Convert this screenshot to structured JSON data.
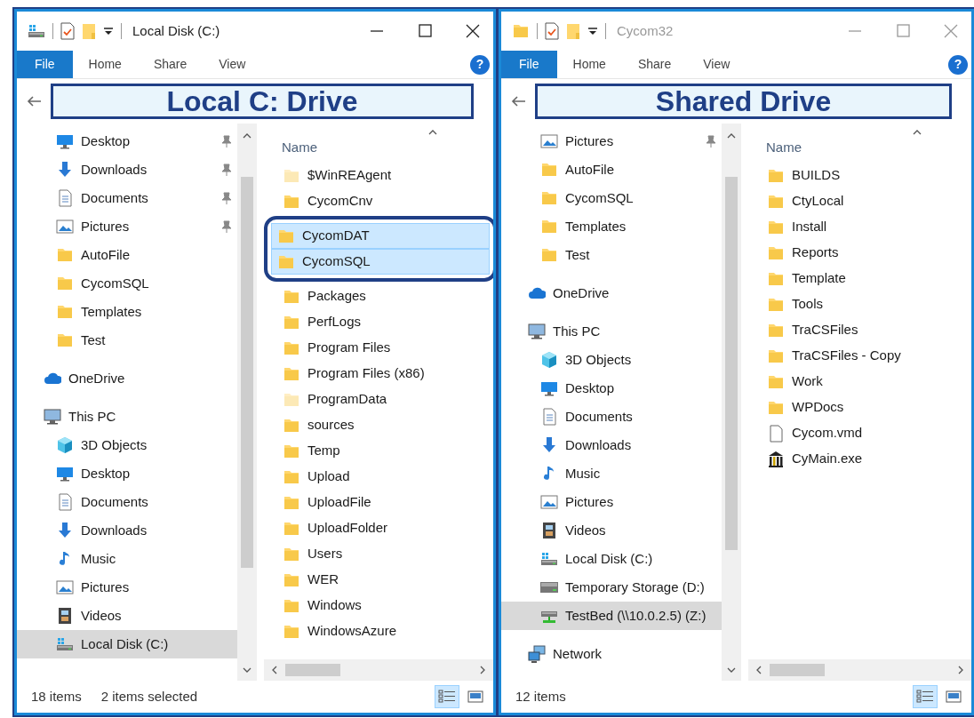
{
  "windows": [
    {
      "title": "Local Disk (C:)",
      "title_icon": {
        "kind": "drive"
      },
      "active": true,
      "ribbon_tabs": [
        {
          "label": "File",
          "selected": true
        },
        {
          "label": "Home",
          "selected": false
        },
        {
          "label": "Share",
          "selected": false
        },
        {
          "label": "View",
          "selected": false
        }
      ],
      "help": "?",
      "banner": "Local C: Drive",
      "nav": [
        {
          "children": [
            {
              "label": "Desktop",
              "kind": "desktop",
              "pinned": true,
              "selected": false
            },
            {
              "label": "Downloads",
              "kind": "downloads",
              "pinned": true,
              "selected": false
            },
            {
              "label": "Documents",
              "kind": "documents",
              "pinned": true,
              "selected": false
            },
            {
              "label": "Pictures",
              "kind": "pictures",
              "pinned": true,
              "selected": false
            },
            {
              "label": "AutoFile",
              "kind": "folder",
              "pinned": false,
              "selected": false
            },
            {
              "label": "CycomSQL",
              "kind": "folder",
              "pinned": false,
              "selected": false
            },
            {
              "label": "Templates",
              "kind": "folder",
              "pinned": false,
              "selected": false
            },
            {
              "label": "Test",
              "kind": "folder",
              "pinned": false,
              "selected": false
            }
          ]
        },
        {
          "label": "OneDrive",
          "kind": "onedrive",
          "selected": false
        },
        {
          "label": "This PC",
          "kind": "pc",
          "selected": false,
          "children": [
            {
              "label": "3D Objects",
              "kind": "objects3d",
              "selected": false
            },
            {
              "label": "Desktop",
              "kind": "desktop",
              "selected": false
            },
            {
              "label": "Documents",
              "kind": "documents",
              "selected": false
            },
            {
              "label": "Downloads",
              "kind": "downloads",
              "selected": false
            },
            {
              "label": "Music",
              "kind": "music",
              "selected": false
            },
            {
              "label": "Pictures",
              "kind": "pictures",
              "selected": false
            },
            {
              "label": "Videos",
              "kind": "videos",
              "selected": false
            },
            {
              "label": "Local Disk (C:)",
              "kind": "drive",
              "selected": true
            }
          ]
        }
      ],
      "file_list": {
        "header": "Name",
        "items": [
          {
            "name": "$WinREAgent",
            "kind": "folder",
            "hidden": true,
            "selected": false
          },
          {
            "name": "CycomCnv",
            "kind": "folder",
            "hidden": false,
            "selected": false
          },
          {
            "name": "CycomDAT",
            "kind": "folder",
            "hidden": false,
            "selected": true
          },
          {
            "name": "CycomSQL",
            "kind": "folder",
            "hidden": false,
            "selected": true
          },
          {
            "name": "Packages",
            "kind": "folder",
            "hidden": false,
            "selected": false
          },
          {
            "name": "PerfLogs",
            "kind": "folder",
            "hidden": false,
            "selected": false
          },
          {
            "name": "Program Files",
            "kind": "folder",
            "hidden": false,
            "selected": false
          },
          {
            "name": "Program Files (x86)",
            "kind": "folder",
            "hidden": false,
            "selected": false
          },
          {
            "name": "ProgramData",
            "kind": "folder",
            "hidden": true,
            "selected": false
          },
          {
            "name": "sources",
            "kind": "folder",
            "hidden": false,
            "selected": false
          },
          {
            "name": "Temp",
            "kind": "folder",
            "hidden": false,
            "selected": false
          },
          {
            "name": "Upload",
            "kind": "folder",
            "hidden": false,
            "selected": false
          },
          {
            "name": "UploadFile",
            "kind": "folder",
            "hidden": false,
            "selected": false
          },
          {
            "name": "UploadFolder",
            "kind": "folder",
            "hidden": false,
            "selected": false
          },
          {
            "name": "Users",
            "kind": "folder",
            "hidden": false,
            "selected": false
          },
          {
            "name": "WER",
            "kind": "folder",
            "hidden": false,
            "selected": false
          },
          {
            "name": "Windows",
            "kind": "folder",
            "hidden": false,
            "selected": false
          },
          {
            "name": "WindowsAzure",
            "kind": "folder",
            "hidden": false,
            "selected": false
          }
        ]
      },
      "status": [
        "18 items",
        "2 items selected"
      ]
    },
    {
      "title": "Cycom32",
      "title_icon": {
        "kind": "folder"
      },
      "active": false,
      "ribbon_tabs": [
        {
          "label": "File",
          "selected": true
        },
        {
          "label": "Home",
          "selected": false
        },
        {
          "label": "Share",
          "selected": false
        },
        {
          "label": "View",
          "selected": false
        }
      ],
      "help": "?",
      "banner": "Shared Drive",
      "nav": [
        {
          "children": [
            {
              "label": "Pictures",
              "kind": "pictures",
              "pinned": true,
              "selected": false
            },
            {
              "label": "AutoFile",
              "kind": "folder",
              "pinned": false,
              "selected": false
            },
            {
              "label": "CycomSQL",
              "kind": "folder",
              "pinned": false,
              "selected": false
            },
            {
              "label": "Templates",
              "kind": "folder",
              "pinned": false,
              "selected": false
            },
            {
              "label": "Test",
              "kind": "folder",
              "pinned": false,
              "selected": false
            }
          ]
        },
        {
          "label": "OneDrive",
          "kind": "onedrive",
          "selected": false
        },
        {
          "label": "This PC",
          "kind": "pc",
          "selected": false,
          "children": [
            {
              "label": "3D Objects",
              "kind": "objects3d",
              "selected": false
            },
            {
              "label": "Desktop",
              "kind": "desktop",
              "selected": false
            },
            {
              "label": "Documents",
              "kind": "documents",
              "selected": false
            },
            {
              "label": "Downloads",
              "kind": "downloads",
              "selected": false
            },
            {
              "label": "Music",
              "kind": "music",
              "selected": false
            },
            {
              "label": "Pictures",
              "kind": "pictures",
              "selected": false
            },
            {
              "label": "Videos",
              "kind": "videos",
              "selected": false
            },
            {
              "label": "Local Disk (C:)",
              "kind": "drive",
              "selected": false
            },
            {
              "label": "Temporary Storage (D:)",
              "kind": "tempdrive",
              "selected": false
            },
            {
              "label": "TestBed (\\\\10.0.2.5) (Z:)",
              "kind": "netdrive",
              "selected": true
            }
          ]
        },
        {
          "label": "Network",
          "kind": "network",
          "selected": false
        }
      ],
      "file_list": {
        "header": "Name",
        "items": [
          {
            "name": "BUILDS",
            "kind": "folder",
            "hidden": false,
            "selected": false
          },
          {
            "name": "CtyLocal",
            "kind": "folder",
            "hidden": false,
            "selected": false
          },
          {
            "name": "Install",
            "kind": "folder",
            "hidden": false,
            "selected": false
          },
          {
            "name": "Reports",
            "kind": "folder",
            "hidden": false,
            "selected": false
          },
          {
            "name": "Template",
            "kind": "folder",
            "hidden": false,
            "selected": false
          },
          {
            "name": "Tools",
            "kind": "folder",
            "hidden": false,
            "selected": false
          },
          {
            "name": "TraCSFiles",
            "kind": "folder",
            "hidden": false,
            "selected": false
          },
          {
            "name": "TraCSFiles - Copy",
            "kind": "folder",
            "hidden": false,
            "selected": false
          },
          {
            "name": "Work",
            "kind": "folder",
            "hidden": false,
            "selected": false
          },
          {
            "name": "WPDocs",
            "kind": "folder",
            "hidden": false,
            "selected": false
          },
          {
            "name": "Cycom.vmd",
            "kind": "file",
            "hidden": false,
            "selected": false
          },
          {
            "name": "CyMain.exe",
            "kind": "exe",
            "hidden": false,
            "selected": false
          }
        ]
      },
      "status": [
        "12 items"
      ]
    }
  ]
}
